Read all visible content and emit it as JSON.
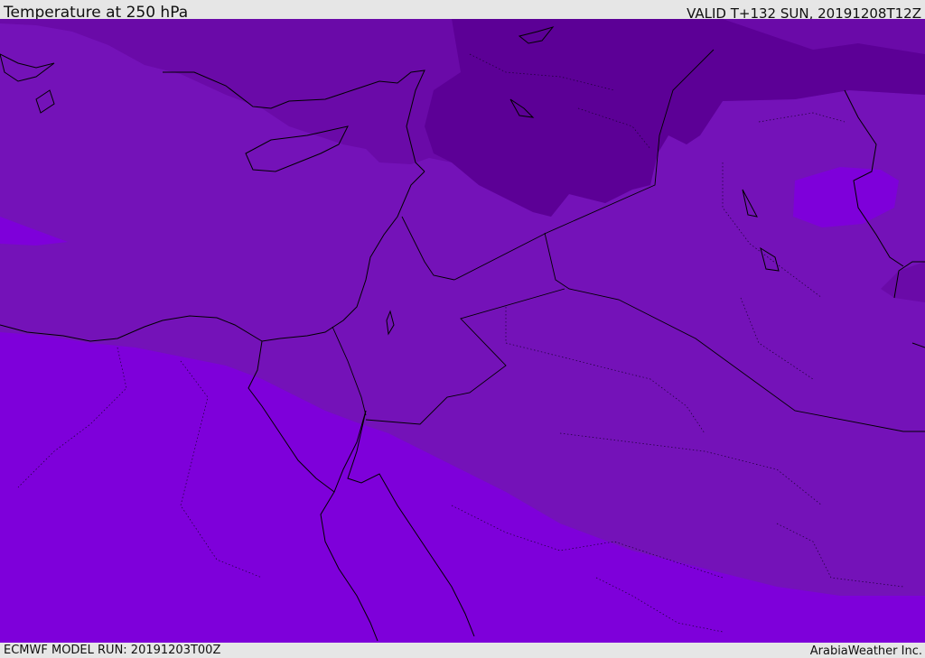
{
  "header": {
    "title": "Temperature at 250 hPa",
    "valid": "VALID T+132 SUN, 20191208T12Z"
  },
  "footer": {
    "model_run": "ECMWF MODEL RUN: 20191203T00Z",
    "credit": "ArabiaWeather Inc."
  },
  "map": {
    "layers": [
      {
        "name": "warmest-band",
        "color": "#7e00da"
      },
      {
        "name": "mid-band",
        "color": "#7412b8"
      },
      {
        "name": "cold-band",
        "color": "#6a0aa8"
      },
      {
        "name": "coldest-band",
        "color": "#5c0096"
      }
    ],
    "coastline_color": "#000000",
    "border_color": "#000000"
  }
}
